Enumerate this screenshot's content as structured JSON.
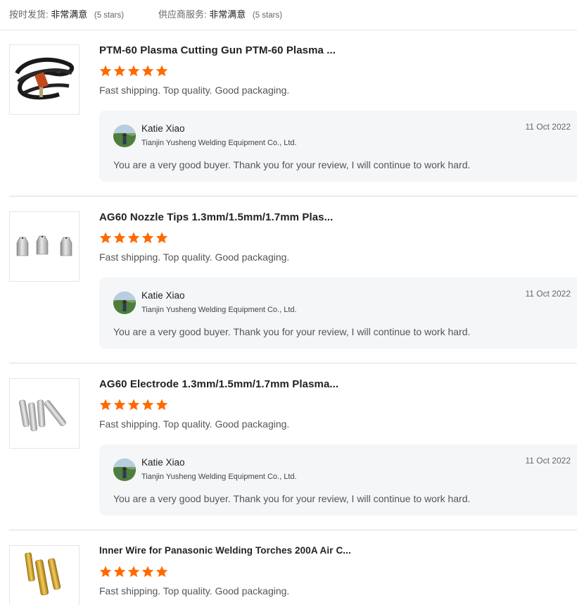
{
  "summary": {
    "delivery_label": "按时发货:",
    "delivery_value": "非常满意",
    "delivery_stars": "(5 stars)",
    "service_label": "供应商服务:",
    "service_value": "非常满意",
    "service_stars": "(5 stars)"
  },
  "reviews": [
    {
      "product_title": "PTM-60 Plasma Cutting Gun PTM-60 Plasma ...",
      "rating": 5,
      "comment": "Fast shipping. Top quality. Good packaging.",
      "reply": {
        "seller_name": "Katie Xiao",
        "company": "Tianjin Yusheng Welding Equipment Co., Ltd.",
        "date": "11 Oct 2022",
        "text": "You are a very good buyer. Thank you for your review, I will continue to work hard."
      }
    },
    {
      "product_title": "AG60 Nozzle Tips 1.3mm/1.5mm/1.7mm Plas...",
      "rating": 5,
      "comment": "Fast shipping. Top quality. Good packaging.",
      "reply": {
        "seller_name": "Katie Xiao",
        "company": "Tianjin Yusheng Welding Equipment Co., Ltd.",
        "date": "11 Oct 2022",
        "text": "You are a very good buyer. Thank you for your review, I will continue to work hard."
      }
    },
    {
      "product_title": "AG60 Electrode 1.3mm/1.5mm/1.7mm Plasma...",
      "rating": 5,
      "comment": "Fast shipping. Top quality. Good packaging.",
      "reply": {
        "seller_name": "Katie Xiao",
        "company": "Tianjin Yusheng Welding Equipment Co., Ltd.",
        "date": "11 Oct 2022",
        "text": "You are a very good buyer. Thank you for your review, I will continue to work hard."
      }
    },
    {
      "product_title": "Inner Wire for Panasonic Welding Torches 200A Air C...",
      "rating": 5,
      "comment": "Fast shipping. Top quality. Good packaging."
    }
  ],
  "colors": {
    "star": "#ff6a00",
    "reply_bg": "#f5f6f8"
  }
}
